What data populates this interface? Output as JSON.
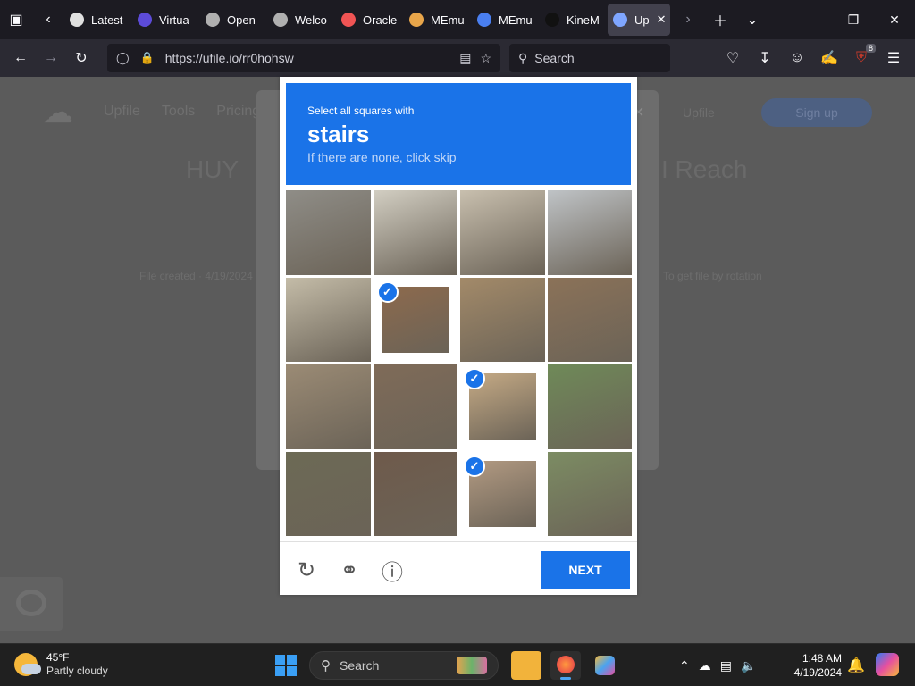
{
  "browser": {
    "tabs": [
      {
        "label": "Latest",
        "color": "#e0e0e0"
      },
      {
        "label": "Virtua",
        "color": "#5c4bd8"
      },
      {
        "label": "Open",
        "color": "#b0b0b0"
      },
      {
        "label": "Welco",
        "color": "#b0b0b0"
      },
      {
        "label": "Oracle",
        "color": "#f05454"
      },
      {
        "label": "MEmu",
        "color": "#e8a54a"
      },
      {
        "label": "MEmu",
        "color": "#4a7ff0"
      },
      {
        "label": "KineM",
        "color": "#111111"
      },
      {
        "label": "Up",
        "color": "#7fa6ff",
        "active": true
      }
    ],
    "url": "https://ufile.io/rr0hohsw",
    "search_placeholder": "Search",
    "ext_badge": "8"
  },
  "page": {
    "nav": [
      "Upfile",
      "Tools",
      "Pricing"
    ],
    "right_link": "Upfile",
    "signin": "Sign up",
    "headline_left": "HUY",
    "headline_right": "I Reach",
    "sub_left": "File created · 4/19/2024",
    "sub_right": "To get file by rotation"
  },
  "captcha": {
    "instruction": "Select all squares with",
    "target": "stairs",
    "hint": "If there are none, click skip",
    "next_label": "NEXT",
    "accent": "#1a73e8",
    "cells": [
      {
        "selected": false,
        "tone": "#8f8d87"
      },
      {
        "selected": false,
        "tone": "#d2cec2"
      },
      {
        "selected": false,
        "tone": "#c8bfae"
      },
      {
        "selected": false,
        "tone": "#bfc3c6"
      },
      {
        "selected": false,
        "tone": "#c4bca8"
      },
      {
        "selected": true,
        "tone": "#8d6a4d"
      },
      {
        "selected": false,
        "tone": "#a38a69"
      },
      {
        "selected": false,
        "tone": "#8b7258"
      },
      {
        "selected": false,
        "tone": "#9b8b75"
      },
      {
        "selected": false,
        "tone": "#7f6b58"
      },
      {
        "selected": true,
        "tone": "#c5aa85"
      },
      {
        "selected": false,
        "tone": "#6f8a58"
      },
      {
        "selected": false,
        "tone": "#6c6a55"
      },
      {
        "selected": false,
        "tone": "#6e5a4b"
      },
      {
        "selected": true,
        "tone": "#b29a82"
      },
      {
        "selected": false,
        "tone": "#7c8c63"
      }
    ]
  },
  "taskbar": {
    "temp": "45°F",
    "condition": "Partly cloudy",
    "search_placeholder": "Search",
    "time": "1:48 AM",
    "date": "4/19/2024"
  }
}
